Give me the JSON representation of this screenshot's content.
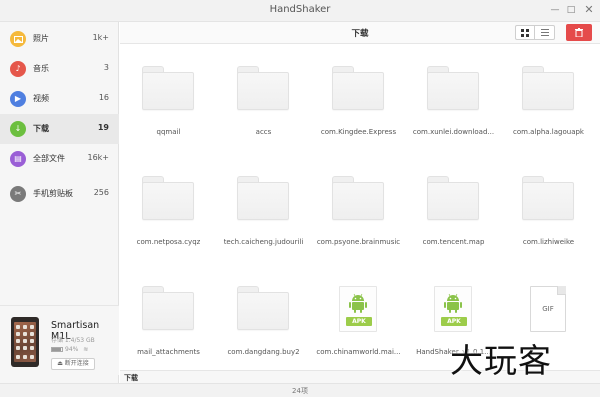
{
  "window": {
    "title": "HandShaker",
    "minimize": "—",
    "maximize": "□",
    "close": "✕"
  },
  "sidebar": {
    "items": [
      {
        "label": "照片",
        "count": "1k+",
        "icon": "photo-icon",
        "color": "#f5b93c",
        "glyph": "▬"
      },
      {
        "label": "音乐",
        "count": "3",
        "icon": "music-icon",
        "color": "#e5574b",
        "glyph": "♪"
      },
      {
        "label": "视频",
        "count": "16",
        "icon": "video-icon",
        "color": "#4f7fe0",
        "glyph": "▶"
      },
      {
        "label": "下载",
        "count": "19",
        "icon": "download-icon",
        "color": "#6cbf3f",
        "glyph": "↓",
        "active": true
      },
      {
        "label": "全部文件",
        "count": "16k+",
        "icon": "all-files-icon",
        "color": "#9a5fd6",
        "glyph": "▤"
      },
      {
        "label": "手机剪贴板",
        "count": "256",
        "icon": "clipboard-icon",
        "color": "#7a7a7a",
        "glyph": "✂"
      }
    ]
  },
  "device": {
    "name": "Smartisan M1L",
    "storage": "存储 1.4/53 GB",
    "battery": "94%",
    "battery_level": 0.94,
    "disconnect_label": "断开连接"
  },
  "toolbar": {
    "title": "下载",
    "grid_view_icon": "grid-view-icon",
    "list_view_icon": "list-view-icon",
    "delete_icon": "trash-icon",
    "delete_color": "#e54b4b"
  },
  "files": [
    {
      "name": "qqmail",
      "type": "folder"
    },
    {
      "name": "accs",
      "type": "folder"
    },
    {
      "name": "com.Kingdee.Express",
      "type": "folder"
    },
    {
      "name": "com.xunlei.download...",
      "type": "folder"
    },
    {
      "name": "com.alpha.lagouapk",
      "type": "folder"
    },
    {
      "name": "com.netposa.cyqz",
      "type": "folder"
    },
    {
      "name": "tech.caicheng.judourili",
      "type": "folder"
    },
    {
      "name": "com.psyone.brainmusic",
      "type": "folder"
    },
    {
      "name": "com.tencent.map",
      "type": "folder"
    },
    {
      "name": "com.lizhiweike",
      "type": "folder"
    },
    {
      "name": "mail_attachments",
      "type": "folder"
    },
    {
      "name": "com.dangdang.buy2",
      "type": "folder"
    },
    {
      "name": "com.chinamworld.mai...",
      "type": "apk",
      "tag": "APK"
    },
    {
      "name": "HandShaker_v1.0.1...",
      "type": "apk",
      "tag": "APK"
    },
    {
      "name": "",
      "type": "gif",
      "tag": "GIF"
    }
  ],
  "status": {
    "path": "下载"
  },
  "footer": {
    "count": "24项"
  },
  "watermark": "大玩客",
  "colors": {
    "apk_green": "#9ccc4a",
    "android_green": "#8bc34a"
  }
}
